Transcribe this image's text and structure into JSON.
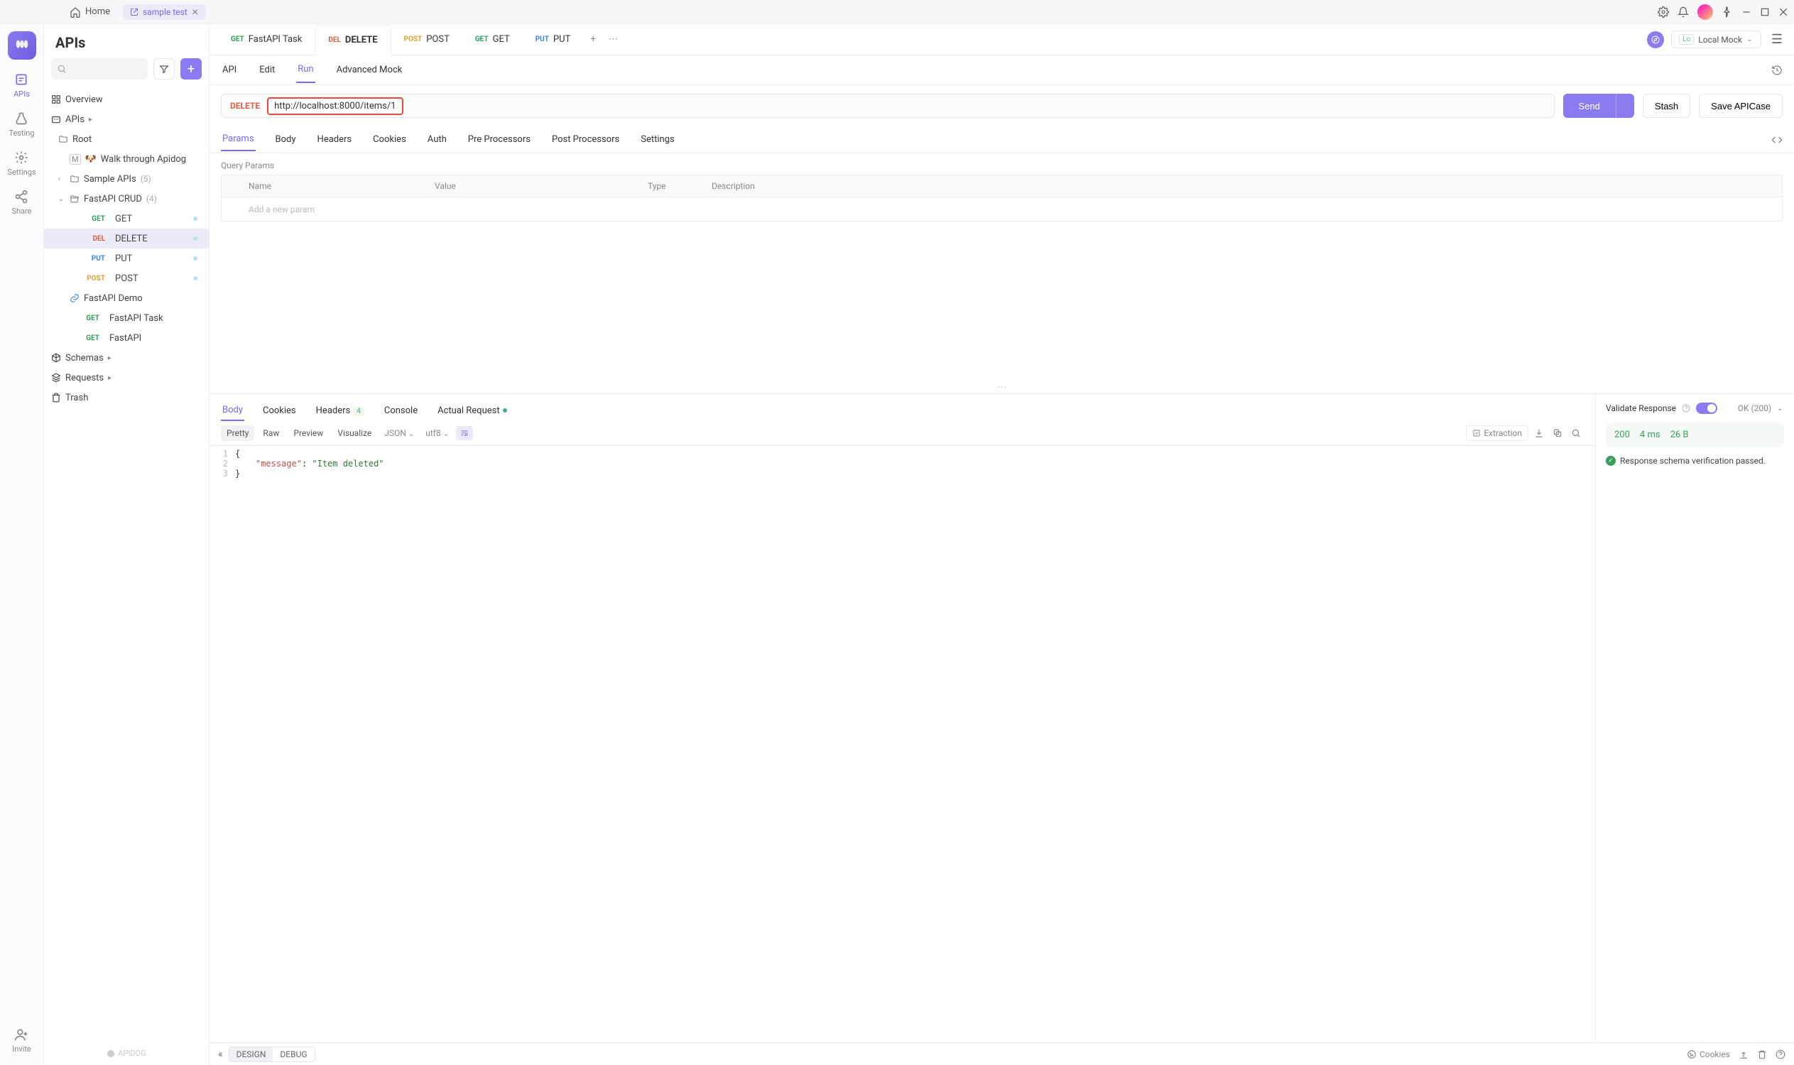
{
  "titlebar": {
    "home": "Home",
    "project_tab": "sample test"
  },
  "rail": {
    "items": [
      {
        "label": "APIs"
      },
      {
        "label": "Testing"
      },
      {
        "label": "Settings"
      },
      {
        "label": "Share"
      },
      {
        "label": "Invite"
      }
    ]
  },
  "sidebar": {
    "title": "APIs",
    "overview": "Overview",
    "apis_label": "APIs",
    "root": "Root",
    "walk_label": "Walk through Apidog",
    "sample_apis": {
      "label": "Sample APIs",
      "count": "(5)"
    },
    "fastapi_crud": {
      "label": "FastAPI CRUD",
      "count": "(4)"
    },
    "crud_items": [
      {
        "method": "GET",
        "mclass": "m-get",
        "label": "GET"
      },
      {
        "method": "DEL",
        "mclass": "m-del",
        "label": "DELETE"
      },
      {
        "method": "PUT",
        "mclass": "m-put",
        "label": "PUT"
      },
      {
        "method": "POST",
        "mclass": "m-post",
        "label": "POST"
      }
    ],
    "fastapi_demo": "FastAPI Demo",
    "extra": [
      {
        "method": "GET",
        "mclass": "m-get",
        "label": "FastAPI Task"
      },
      {
        "method": "GET",
        "mclass": "m-get",
        "label": "FastAPI"
      }
    ],
    "schemas": "Schemas",
    "requests": "Requests",
    "trash": "Trash",
    "footer": "APIDOG"
  },
  "tabs": [
    {
      "method": "GET",
      "mclass": "m-get",
      "label": "FastAPI Task"
    },
    {
      "method": "DEL",
      "mclass": "m-del",
      "label": "DELETE"
    },
    {
      "method": "POST",
      "mclass": "m-post",
      "label": "POST"
    },
    {
      "method": "GET",
      "mclass": "m-get",
      "label": "GET"
    },
    {
      "method": "PUT",
      "mclass": "m-put",
      "label": "PUT"
    }
  ],
  "env": {
    "badge": "Lo",
    "label": "Local Mock"
  },
  "subtabs": {
    "api": "API",
    "edit": "Edit",
    "run": "Run",
    "mock": "Advanced Mock"
  },
  "url_row": {
    "method": "DELETE",
    "url": "http://localhost:8000/items/1",
    "send": "Send",
    "stash": "Stash",
    "save": "Save APICase"
  },
  "req_tabs": {
    "params": "Params",
    "body": "Body",
    "headers": "Headers",
    "cookies": "Cookies",
    "auth": "Auth",
    "pre": "Pre Processors",
    "post": "Post Processors",
    "settings": "Settings"
  },
  "query": {
    "title": "Query Params",
    "cols": {
      "name": "Name",
      "value": "Value",
      "type": "Type",
      "desc": "Description"
    },
    "placeholder": "Add a new param"
  },
  "resp_tabs": {
    "body": "Body",
    "cookies": "Cookies",
    "headers": "Headers",
    "headers_count": "4",
    "console": "Console",
    "actual": "Actual Request"
  },
  "viewer": {
    "pretty": "Pretty",
    "raw": "Raw",
    "preview": "Preview",
    "visualize": "Visualize",
    "format": "JSON",
    "enc": "utf8",
    "extraction": "Extraction"
  },
  "response_body": {
    "message_key": "\"message\"",
    "message_val": "\"Item deleted\""
  },
  "validate": {
    "label": "Validate Response",
    "status": "OK (200)"
  },
  "stats": {
    "code": "200",
    "time": "4 ms",
    "size": "26 B"
  },
  "verify_msg": "Response schema verification passed.",
  "bottom": {
    "design": "DESIGN",
    "debug": "DEBUG",
    "cookies": "Cookies"
  }
}
